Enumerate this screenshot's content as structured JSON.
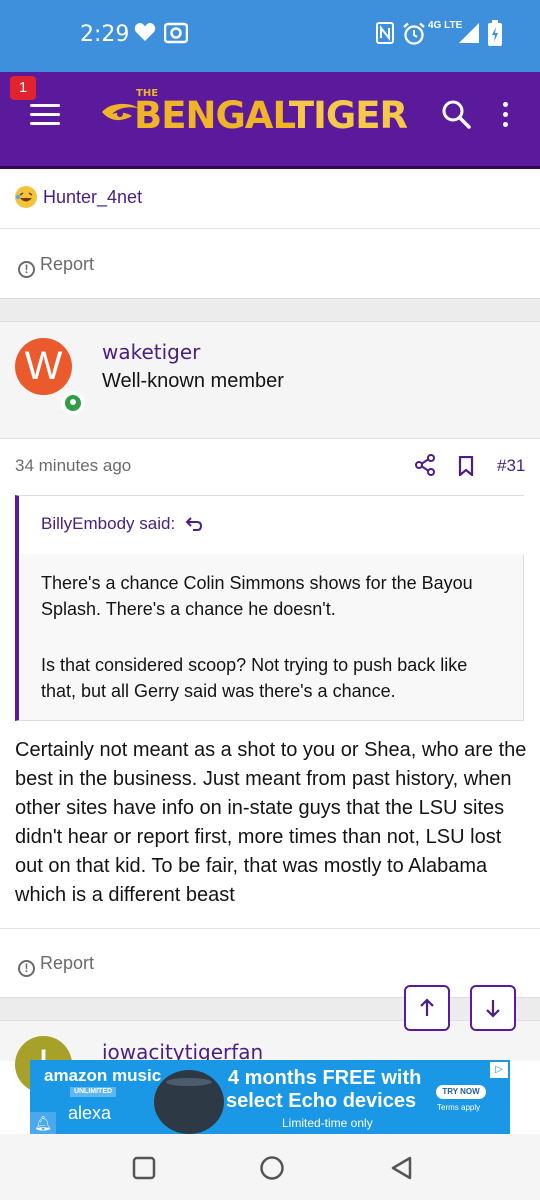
{
  "status_bar": {
    "time": "2:29",
    "network": "4G LTE"
  },
  "header": {
    "notification_count": "1",
    "logo_the": "THE",
    "logo_bengal": "BENGAL",
    "logo_tiger": "TIGER"
  },
  "previous_post": {
    "reaction_user": "Hunter_4net",
    "report_label": "Report"
  },
  "post": {
    "avatar_letter": "W",
    "username": "waketiger",
    "user_title": "Well-known member",
    "time_ago": "34 minutes ago",
    "post_number": "#31",
    "quote": {
      "author_line": "BillyEmbody said:",
      "paragraph_1": "There's a chance Colin Simmons shows for the Bayou Splash. There's a chance he doesn't.",
      "paragraph_2": "Is that considered scoop? Not trying to push back like that, but all Gerry said was there's a chance."
    },
    "body": "Certainly not meant as a shot to you or Shea, who are the best in the business. Just meant from past history, when other sites have info on in-state guys that the LSU sites didn't hear or report first, more times than not, LSU lost out on that kid. To be fair, that was mostly to Alabama which is a different beast",
    "report_label": "Report"
  },
  "next_post": {
    "avatar_letter": "I",
    "username": "iowacitytigerfan"
  },
  "ad": {
    "brand": "amazon music",
    "brand_tag": "UNLIMITED",
    "assistant": "alexa",
    "headline_1": "4 months FREE with",
    "headline_2": "select Echo devices",
    "subline": "Limited-time only",
    "cta": "TRY NOW",
    "terms": "Terms apply"
  },
  "colors": {
    "header": "#5b1a9b",
    "status_bar": "#3f90dc",
    "link": "#4a1e84",
    "logo": "#f0b429",
    "ad": "#1a98e6"
  }
}
